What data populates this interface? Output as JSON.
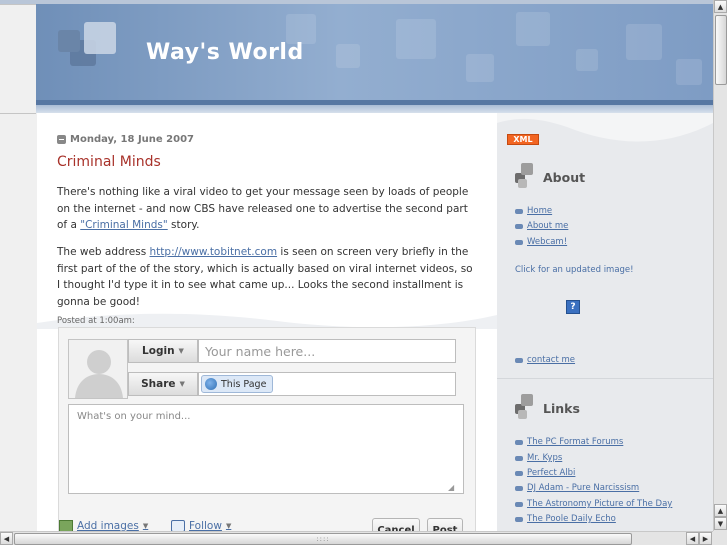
{
  "blog": {
    "title": "Way's World"
  },
  "post": {
    "date": "Monday, 18 June 2007",
    "title": "Criminal Minds",
    "p1_before": "There's nothing like a viral video to get your message seen by loads of people on the internet - and now CBS have released one to advertise the second part of a ",
    "p1_link": "\"Criminal Minds\"",
    "p1_after": " story.",
    "p2_before": "The web address ",
    "p2_link": "http://www.tobitnet.com",
    "p2_after": " is seen on screen very briefly in the first part of the of the story, which is actually based on viral internet videos, so I thought I'd type it in to see what came up... Looks the second installment is gonna be good!",
    "posted_at": "Posted at 1:00am:"
  },
  "comment": {
    "login_label": "Login",
    "name_placeholder": "Your name here...",
    "share_label": "Share",
    "share_chip": "This Page",
    "mind_placeholder": "What's on your mind...",
    "add_images": "Add images",
    "follow": "Follow",
    "cancel": "Cancel",
    "post": "Post"
  },
  "sidebar": {
    "xml_badge": "XML",
    "about": {
      "title": "About",
      "links": [
        "Home",
        "About me",
        "Webcam!"
      ],
      "note": "Click for an updated image!",
      "image_placeholder": "?",
      "contact": "contact me"
    },
    "links": {
      "title": "Links",
      "items": [
        "The PC Format Forums",
        "Mr. Kyps",
        "Perfect Albi",
        "DJ Adam - Pure Narcissism",
        "The Astronomy Picture of The Day",
        "The Poole Daily Echo"
      ]
    }
  },
  "scrollbar": {
    "grip": "::::"
  },
  "colors": {
    "title_red": "#a8322a",
    "link_blue": "#4a6fa5",
    "header_blue": "#7e9cc4",
    "xml_orange": "#f26522"
  }
}
